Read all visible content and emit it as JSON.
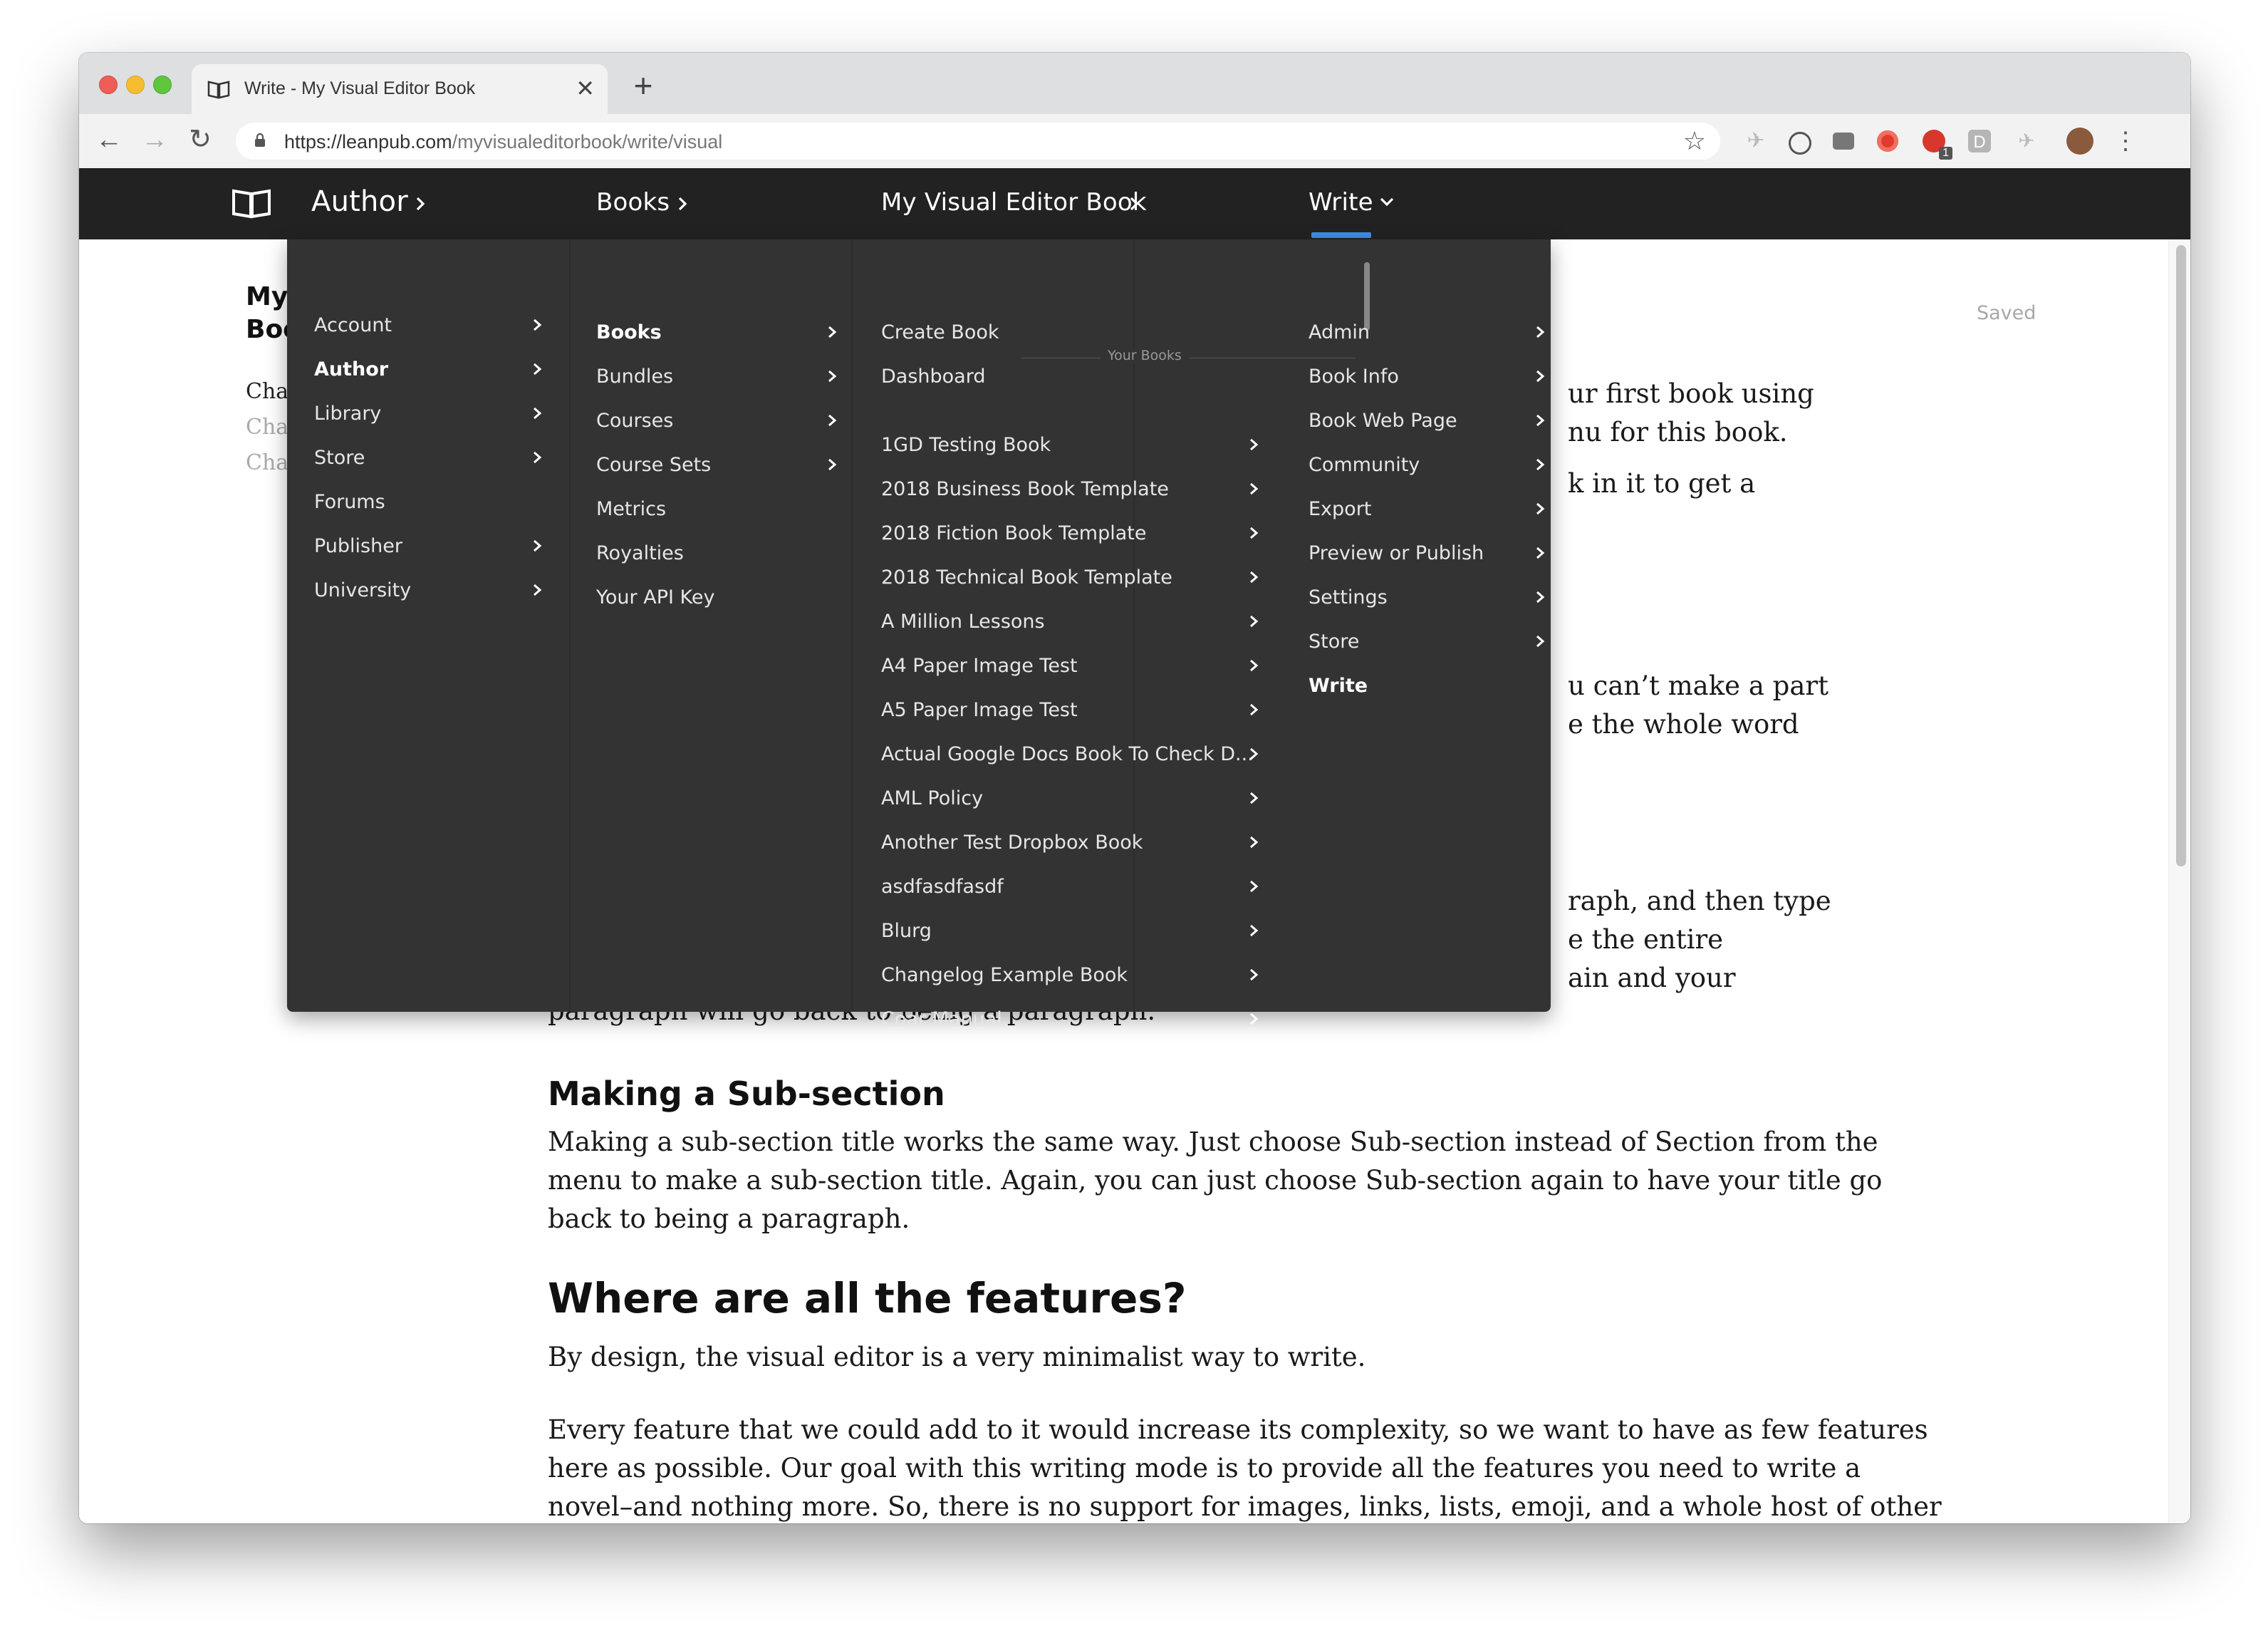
{
  "browser": {
    "tab_title": "Write - My Visual Editor Book",
    "url_host": "https://leanpub.com",
    "url_path": "/myvisualeditorbook/write/visual",
    "extension_badge": "1",
    "extension_letter": "D"
  },
  "appbar": {
    "breadcrumbs": [
      "Author",
      "Books",
      "My Visual Editor Book",
      "Write"
    ]
  },
  "menu": {
    "col1": [
      {
        "label": "Account",
        "arrow": true
      },
      {
        "label": "Author",
        "arrow": true,
        "active": true
      },
      {
        "label": "Library",
        "arrow": true
      },
      {
        "label": "Store",
        "arrow": true
      },
      {
        "label": "Forums",
        "arrow": false
      },
      {
        "label": "Publisher",
        "arrow": true
      },
      {
        "label": "University",
        "arrow": true
      }
    ],
    "col2": [
      {
        "label": "Books",
        "arrow": true,
        "active": true
      },
      {
        "label": "Bundles",
        "arrow": true
      },
      {
        "label": "Courses",
        "arrow": true
      },
      {
        "label": "Course Sets",
        "arrow": true
      },
      {
        "label": "Metrics",
        "arrow": false
      },
      {
        "label": "Royalties",
        "arrow": false
      },
      {
        "label": "Your API Key",
        "arrow": false
      }
    ],
    "col3_top": [
      "Create Book",
      "Dashboard"
    ],
    "col3_group_label": "Your Books",
    "col3_books": [
      "1GD Testing Book",
      "2018 Business Book Template",
      "2018 Fiction Book Template",
      "2018 Technical Book Template",
      "A Million Lessons",
      "A4 Paper Image Test",
      "A5 Paper Image Test",
      "Actual Google Docs Book To Check D...",
      "AML Policy",
      "Another Test Dropbox Book",
      "asdfasdfasdf",
      "Blurg",
      "Changelog Example Book",
      "Coar Manual"
    ],
    "col4": [
      {
        "label": "Admin",
        "arrow": true
      },
      {
        "label": "Book Info",
        "arrow": true
      },
      {
        "label": "Book Web Page",
        "arrow": true
      },
      {
        "label": "Community",
        "arrow": true
      },
      {
        "label": "Export",
        "arrow": true
      },
      {
        "label": "Preview or Publish",
        "arrow": true
      },
      {
        "label": "Settings",
        "arrow": true
      },
      {
        "label": "Store",
        "arrow": true
      },
      {
        "label": "Write",
        "arrow": false,
        "active": true
      }
    ]
  },
  "sidebar": {
    "title_line1": "My",
    "title_line2": "Boo",
    "chapters": [
      "Chap",
      "Chap",
      "Chap"
    ]
  },
  "editor": {
    "status": "Saved",
    "clipped_lines": [
      "ur first book using",
      "nu for this book.",
      "k in it to get a",
      "u can’t make a part",
      "e the whole word",
      "raph, and then type",
      "e the entire",
      "ain and your",
      "paragraph will go back to being a paragraph."
    ],
    "subsection_heading": "Making a Sub-section",
    "subsection_lines": [
      "Making a sub-section title works the same way. Just choose Sub-section instead of Section from the",
      "menu to make a sub-section title. Again, you can just choose Sub-section again to have your title go",
      "back to being a paragraph."
    ],
    "features_heading": "Where are all the features?",
    "features_intro": "By design, the visual editor is a very minimalist way to write.",
    "features_lines": [
      "Every feature that we could add to it would increase its complexity, so we want to have as few features",
      "here as possible. Our goal with this writing mode is to provide all the features you need to write a",
      "novel–and nothing more. So, there is no support for images, links, lists, emoji, and a whole host of other"
    ]
  },
  "colors": {
    "appbar": "#222222",
    "menu_bg": "#333333",
    "accent": "#3d8fe8"
  }
}
